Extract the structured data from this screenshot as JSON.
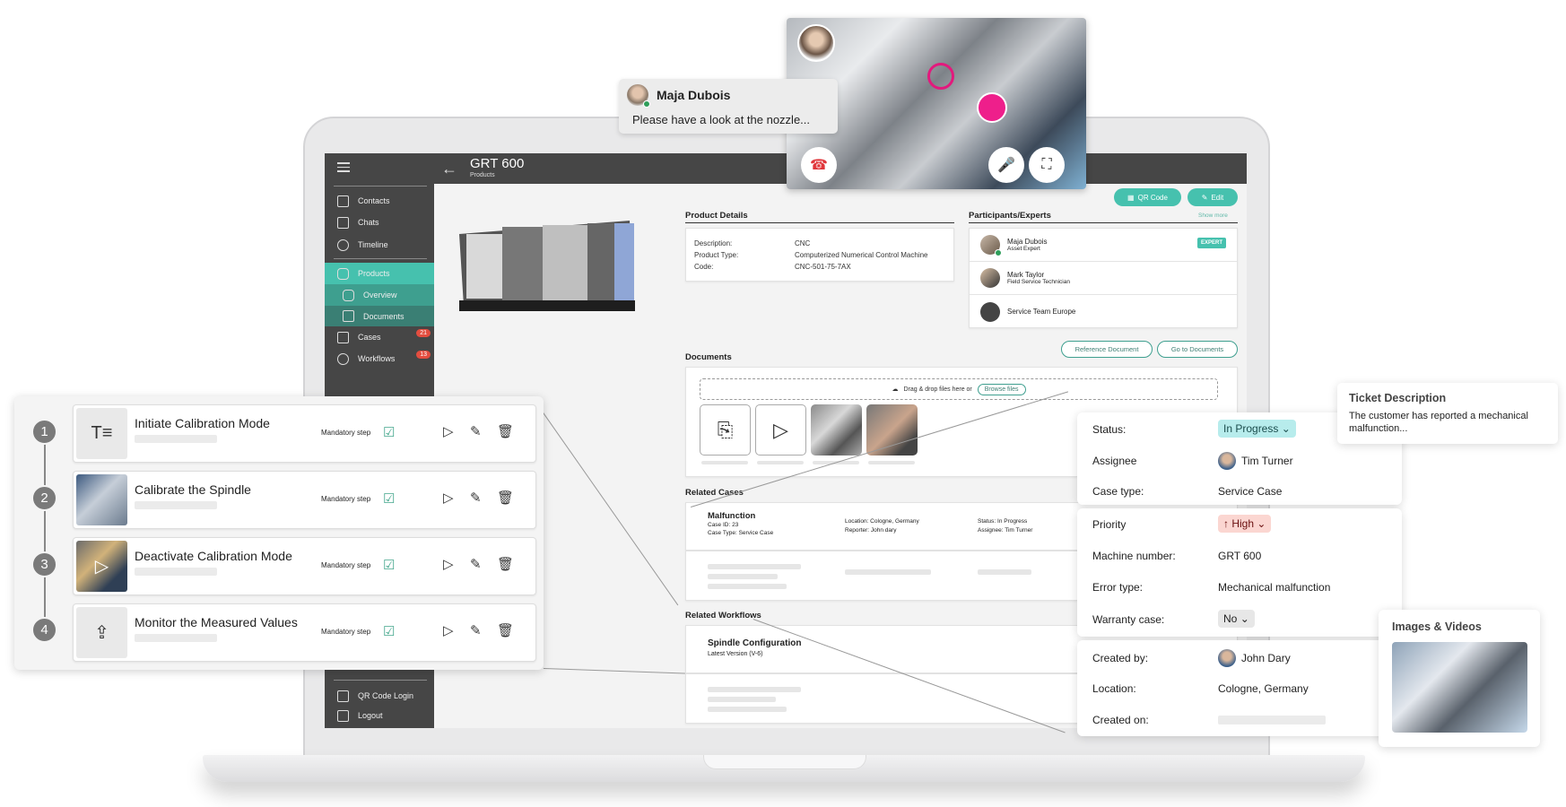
{
  "app": {
    "header": {
      "title": "GRT 600",
      "subtitle": "Products",
      "back_icon": "arrow-left-icon"
    },
    "sidebar": {
      "menu_icon": "hamburger-icon",
      "items": [
        {
          "label": "Contacts",
          "icon": "contact-card-icon"
        },
        {
          "label": "Chats",
          "icon": "chat-bubble-icon"
        },
        {
          "label": "Timeline",
          "icon": "clock-icon"
        },
        {
          "label": "Products",
          "icon": "product-hex-icon",
          "active": true
        },
        {
          "label": "Overview",
          "icon": "product-hex-icon",
          "sub": true
        },
        {
          "label": "Documents",
          "icon": "document-icon",
          "sub": true
        },
        {
          "label": "Cases",
          "icon": "cases-icon",
          "badge": "21"
        },
        {
          "label": "Workflows",
          "icon": "workflow-icon",
          "badge": "13"
        }
      ],
      "bottom_items": [
        {
          "label": "QR Code Login",
          "icon": "qr-code-icon"
        },
        {
          "label": "Logout",
          "icon": "logout-icon"
        }
      ]
    },
    "actions": {
      "qr_code": "QR Code",
      "edit": "Edit",
      "show_more": "Show more"
    },
    "product_details": {
      "title": "Product Details",
      "rows": [
        {
          "label": "Description:",
          "value": "CNC"
        },
        {
          "label": "Product Type:",
          "value": "Computerized Numerical Control Machine"
        },
        {
          "label": "Code:",
          "value": "CNC-501-75-7AX"
        }
      ]
    },
    "participants": {
      "title": "Participants/Experts",
      "items": [
        {
          "name": "Maja Dubois",
          "role": "Asset Expert",
          "badge": "EXPERT",
          "online": true
        },
        {
          "name": "Mark Taylor",
          "role": "Field Service Technician"
        },
        {
          "name": "Service Team Europe",
          "role": ""
        }
      ]
    },
    "documents": {
      "title": "Documents",
      "reference_button": "Reference Document",
      "goto_button": "Go to Documents",
      "dropzone_text": "Drag & drop files here or",
      "browse_label": "Browse files",
      "thumbs": [
        "pdf-file-icon",
        "video-file-icon",
        "image",
        "image"
      ]
    },
    "related_cases": {
      "title": "Related Cases",
      "items": [
        {
          "title": "Malfunction",
          "case_id": "Case ID: 23",
          "case_type": "Case Type: Service Case",
          "location": "Location: Cologne, Germany",
          "reporter": "Reporter: John dary",
          "status": "Status: In Progress",
          "assignee": "Assignee: Tim Turner"
        }
      ]
    },
    "related_workflows": {
      "title": "Related Workflows",
      "items": [
        {
          "title": "Spindle Configuration",
          "version": "Latest Version (V-6)"
        }
      ]
    }
  },
  "video_call": {
    "chat": {
      "name": "Maja Dubois",
      "message": "Please have a look at the nozzle..."
    },
    "controls": [
      "end-call-icon",
      "microphone-icon",
      "fullscreen-icon"
    ],
    "annotation_color": "#ee1f8b"
  },
  "workflow_steps": {
    "mandatory_label": "Mandatory step",
    "steps": [
      {
        "number": "1",
        "title": "Initiate Calibration Mode",
        "thumb": "text-format-icon"
      },
      {
        "number": "2",
        "title": "Calibrate the Spindle",
        "thumb": "photo"
      },
      {
        "number": "3",
        "title": "Deactivate Calibration Mode",
        "thumb": "video"
      },
      {
        "number": "4",
        "title": "Monitor the Measured Values",
        "thumb": "image-upload-icon"
      }
    ]
  },
  "case_details": {
    "group1": [
      {
        "label": "Status:",
        "value": "In Progress",
        "type": "chip-progress"
      },
      {
        "label": "Assignee",
        "value": "Tim Turner",
        "type": "avatar"
      },
      {
        "label": "Case type:",
        "value": "Service Case"
      }
    ],
    "group2": [
      {
        "label": "Priority",
        "value": "High",
        "type": "chip-high"
      },
      {
        "label": "Machine number:",
        "value": "GRT 600"
      },
      {
        "label": "Error type:",
        "value": "Mechanical malfunction"
      },
      {
        "label": "Warranty case:",
        "value": "No",
        "type": "chip-no"
      }
    ],
    "group3": [
      {
        "label": "Created by:",
        "value": "John Dary",
        "type": "avatar"
      },
      {
        "label": "Location:",
        "value": "Cologne, Germany"
      },
      {
        "label": "Created on:",
        "value": ""
      }
    ]
  },
  "ticket": {
    "title": "Ticket Description",
    "text": "The customer has reported a mechanical malfunction..."
  },
  "images_videos": {
    "title": "Images & Videos"
  },
  "colors": {
    "accent": "#46c1ae",
    "sidebar": "#464646",
    "badge": "#e34d3f",
    "progress_chip": "#b7ecec",
    "high_chip": "#fbd6d1"
  }
}
